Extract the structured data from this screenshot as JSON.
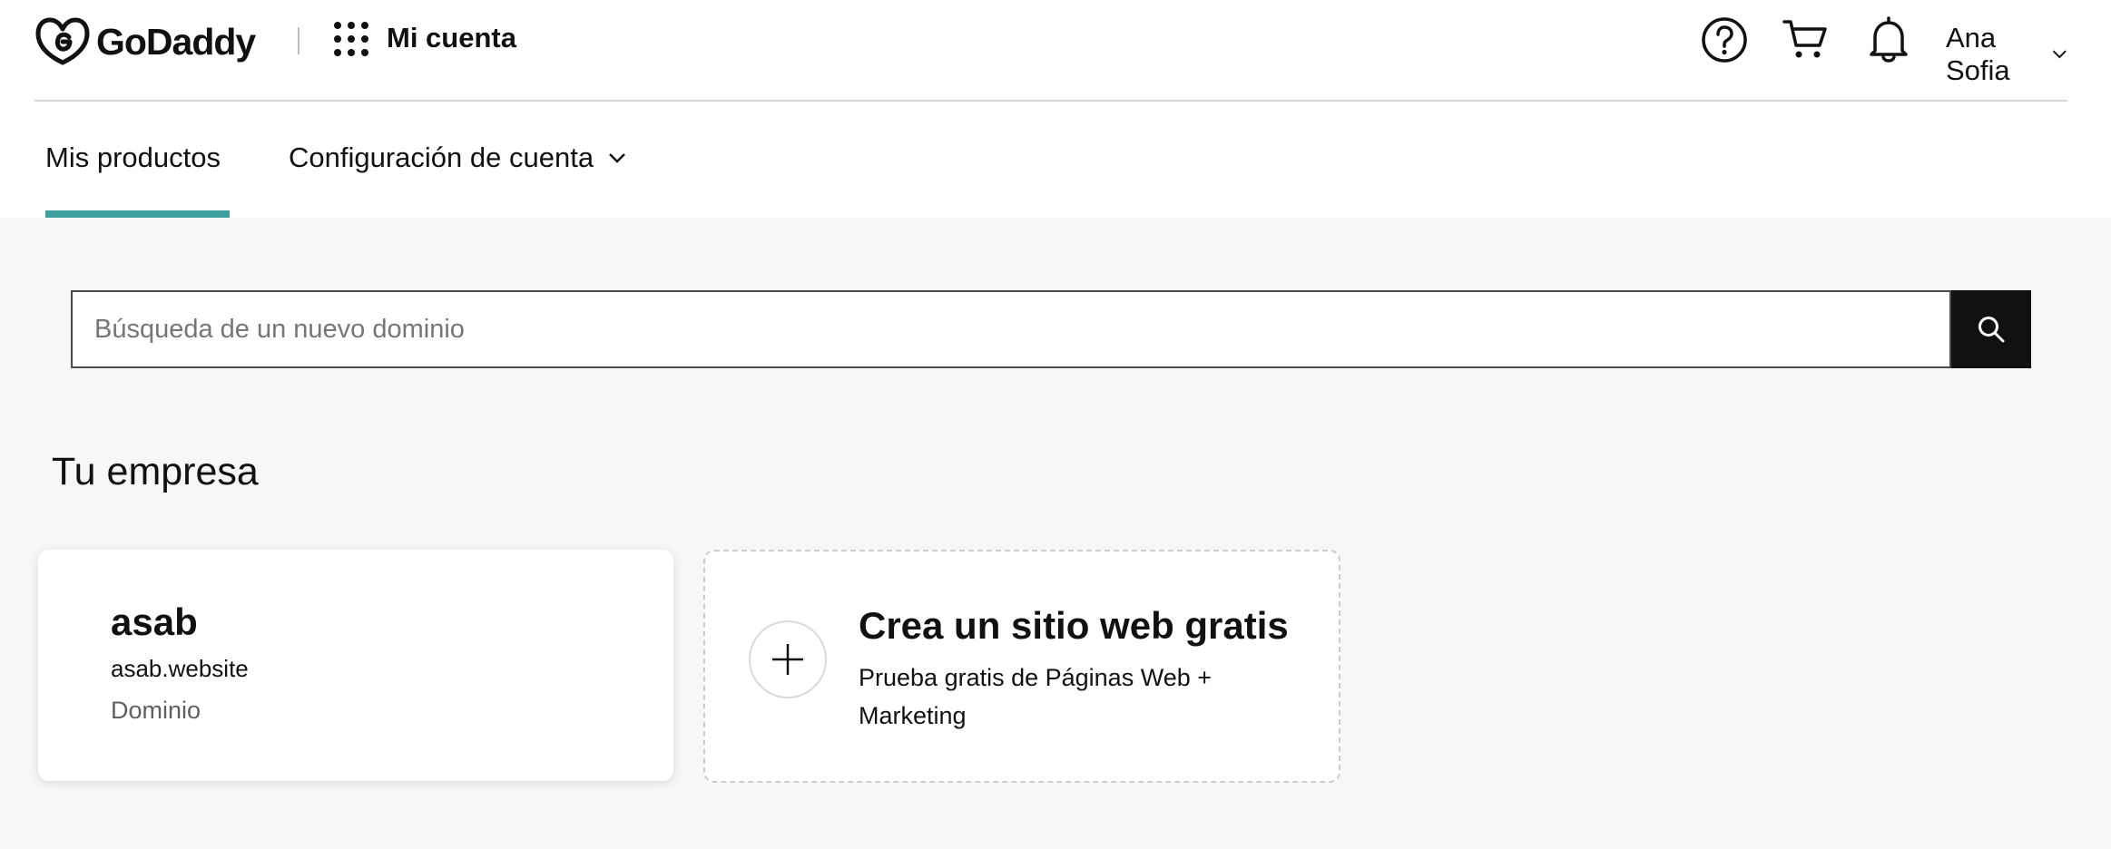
{
  "header": {
    "brand": "GoDaddy",
    "account_title": "Mi cuenta",
    "user_name": "Ana Sofia",
    "icons": {
      "logo": "godaddy-logo-icon",
      "apps": "grid-apps-icon",
      "help": "help-circle-icon",
      "cart": "cart-icon",
      "notifications": "bell-icon",
      "user_menu": "chevron-down-icon"
    }
  },
  "nav": {
    "tabs": [
      {
        "label": "Mis productos",
        "active": true
      },
      {
        "label": "Configuración de cuenta",
        "active": false,
        "has_dropdown": true
      }
    ],
    "active_color": "#3fa19d"
  },
  "search": {
    "placeholder": "Búsqueda de un nuevo dominio",
    "value": "",
    "button_icon": "search-icon"
  },
  "business": {
    "section_title": "Tu empresa",
    "product": {
      "name": "asab",
      "domain": "asab.website",
      "type": "Dominio"
    },
    "create_site": {
      "title": "Crea un sitio web gratis",
      "description": "Prueba gratis de Páginas Web + Marketing",
      "icon": "plus-icon"
    }
  },
  "colors": {
    "page_background": "#f5f7f8",
    "header_background": "#ffffff",
    "text": "#111111",
    "search_button": "#111111"
  }
}
